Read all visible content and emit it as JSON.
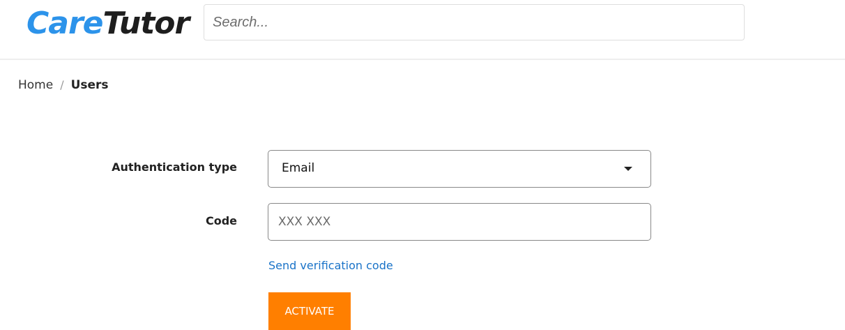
{
  "header": {
    "logo_part1": "Care",
    "logo_part2": "Tutor",
    "search_placeholder": "Search..."
  },
  "breadcrumb": {
    "home": "Home",
    "separator": "/",
    "current": "Users"
  },
  "form": {
    "auth_type_label": "Authentication type",
    "auth_type_value": "Email",
    "code_label": "Code",
    "code_placeholder": "XXX XXX",
    "send_link": "Send verification code",
    "activate_button": "ACTIVATE"
  },
  "colors": {
    "brand_blue": "#2c93ea",
    "link_blue": "#1a73c8",
    "accent_orange": "#ff7f00"
  }
}
